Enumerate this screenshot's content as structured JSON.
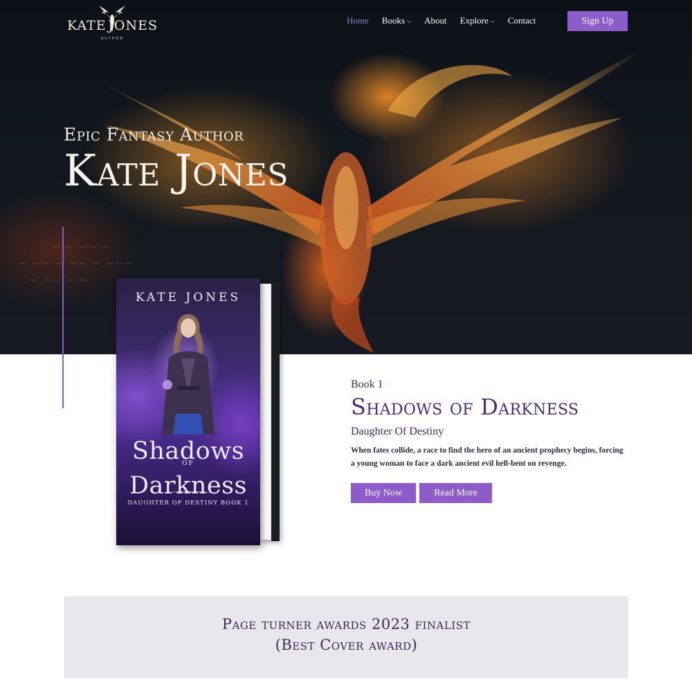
{
  "colors": {
    "accent": "#8e5cc8",
    "nav_active": "#9b7bd8",
    "title_purple": "#4a2f77",
    "award_bg": "#e7e7ec"
  },
  "logo": {
    "left": "KATE",
    "right": "JONES",
    "sub": "AUTHOR",
    "icon": "phoenix-icon"
  },
  "nav": {
    "items": [
      {
        "label": "Home",
        "active": true,
        "dropdown": false
      },
      {
        "label": "Books",
        "active": false,
        "dropdown": true
      },
      {
        "label": "About",
        "active": false,
        "dropdown": false
      },
      {
        "label": "Explore",
        "active": false,
        "dropdown": true
      },
      {
        "label": "Contact",
        "active": false,
        "dropdown": false
      }
    ],
    "cta": "Sign Up"
  },
  "hero": {
    "subtitle": "Epic Fantasy Author",
    "title": "Kate Jones"
  },
  "book": {
    "cover": {
      "author": "KATE JONES",
      "title_line1": "Shadows",
      "of": "OF",
      "title_line2": "Darkness",
      "series": "DAUGHTER OF DESTINY BOOK 1"
    },
    "label": "Book 1",
    "title": "Shadows of Darkness",
    "subtitle": "Daughter Of Destiny",
    "description": "When fates collide, a race to find the hero of an ancient prophecy begins, forcing a young woman to face a dark ancient evil hell-bent on revenge.",
    "buy_label": "Buy Now",
    "read_label": "Read More"
  },
  "award": {
    "line1": "Page turner awards 2023 finalist",
    "line2": "(Best Cover award)"
  }
}
